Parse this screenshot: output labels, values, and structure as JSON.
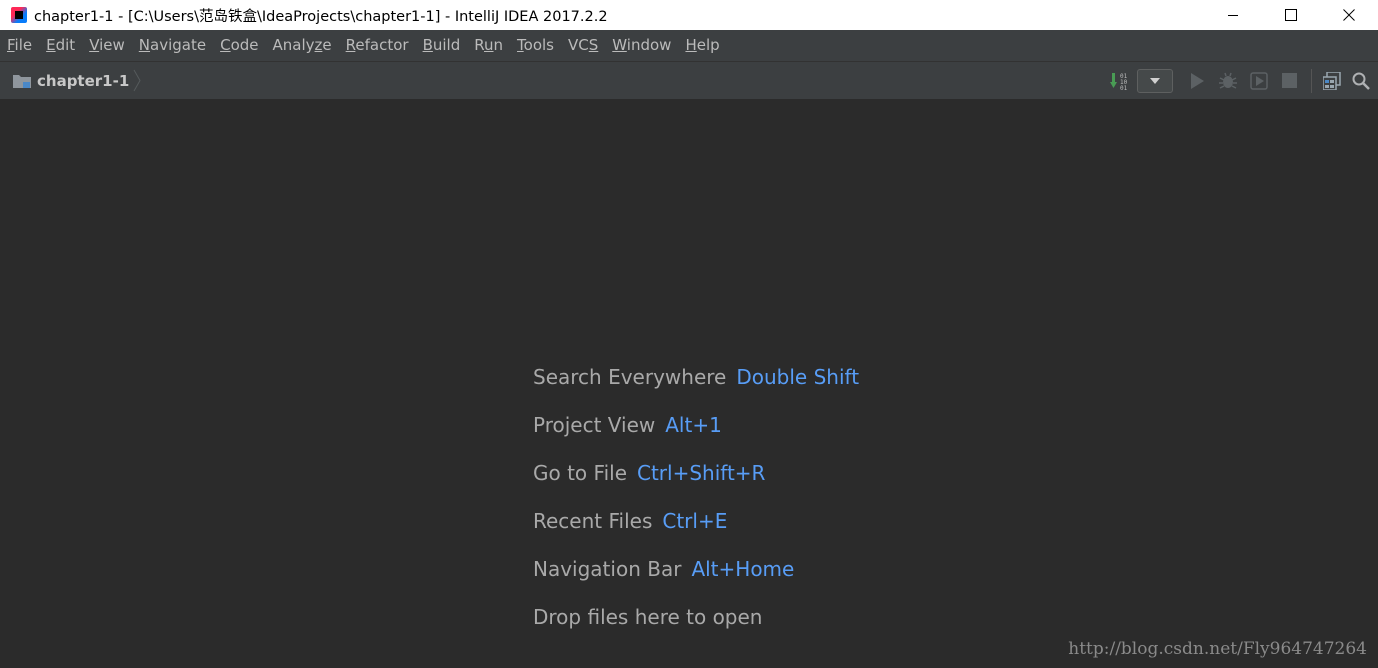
{
  "window": {
    "title": "chapter1-1 - [C:\\Users\\范岛铁盒\\IdeaProjects\\chapter1-1] - IntelliJ IDEA 2017.2.2",
    "icon": "intellij-idea-icon"
  },
  "menu": [
    {
      "mnemonic": "F",
      "rest": "ile"
    },
    {
      "mnemonic": "E",
      "rest": "dit"
    },
    {
      "mnemonic": "V",
      "rest": "iew"
    },
    {
      "mnemonic": "N",
      "rest": "avigate"
    },
    {
      "mnemonic": "C",
      "rest": "ode"
    },
    {
      "pre": "Analy",
      "mnemonic": "z",
      "rest": "e"
    },
    {
      "mnemonic": "R",
      "rest": "efactor"
    },
    {
      "mnemonic": "B",
      "rest": "uild"
    },
    {
      "pre": "R",
      "mnemonic": "u",
      "rest": "n"
    },
    {
      "mnemonic": "T",
      "rest": "ools"
    },
    {
      "pre": "VC",
      "mnemonic": "S",
      "rest": ""
    },
    {
      "mnemonic": "W",
      "rest": "indow"
    },
    {
      "mnemonic": "H",
      "rest": "elp"
    }
  ],
  "navbar": {
    "project": "chapter1-1",
    "icons": [
      "folder-icon",
      "build-icon",
      "run-config-dropdown-icon",
      "run-icon",
      "debug-icon",
      "coverage-icon",
      "stop-icon",
      "project-structure-icon",
      "search-icon"
    ]
  },
  "hints": [
    {
      "label": "Search Everywhere",
      "key": "Double Shift"
    },
    {
      "label": "Project View",
      "key": "Alt+1"
    },
    {
      "label": "Go to File",
      "key": "Ctrl+Shift+R"
    },
    {
      "label": "Recent Files",
      "key": "Ctrl+E"
    },
    {
      "label": "Navigation Bar",
      "key": "Alt+Home"
    },
    {
      "label": "Drop files here to open",
      "key": ""
    }
  ],
  "watermark": "http://blog.csdn.net/Fly964747264",
  "colors": {
    "editor_bg": "#2b2b2b",
    "bar_bg": "#3c3f41",
    "hint_text": "#a9a9a9",
    "shortcut": "#589df6"
  }
}
